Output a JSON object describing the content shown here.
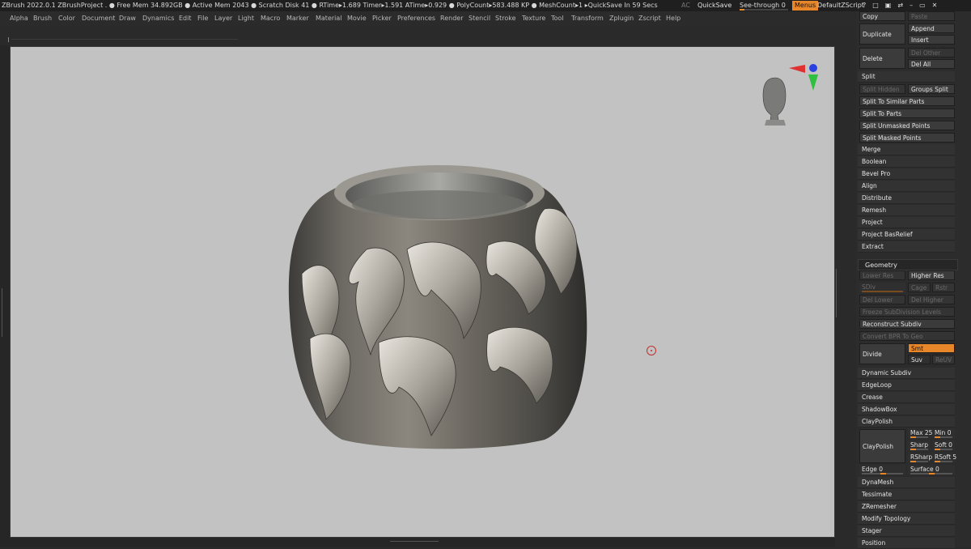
{
  "titlebar": {
    "text": "ZBrush 2022.0.1    ZBrushProject    . ● Free Mem 34.892GB ● Active Mem 2043 ● Scratch Disk 41 ●  RTime▸1.689 Timer▸1.591 ATime▸0.929 ● PolyCount▸583.488 KP ● MeshCount▸1    ▸QuickSave In 59 Secs",
    "ac": "AC",
    "quicksave": "QuickSave",
    "see_through": "See-through  0",
    "see_through_value": 0,
    "menus": "Menus",
    "default_zscript": "DefaultZScript",
    "icon_names": [
      "help-icon",
      "layout-icon",
      "palette-icon",
      "swap-icon",
      "minimize-icon",
      "maximize-icon",
      "close-icon"
    ],
    "icon_glyphs": "?□▣⇄–▭✕"
  },
  "menubar": [
    "Alpha",
    "Brush",
    "Color",
    "Document",
    "Draw",
    "Dynamics",
    "Edit",
    "File",
    "Layer",
    "Light",
    "Macro",
    "Marker",
    "Material",
    "Movie",
    "Picker",
    "Preferences",
    "Render",
    "Stencil",
    "Stroke",
    "Texture",
    "Tool",
    "Transform",
    "Zplugin",
    "Zscript",
    "Help"
  ],
  "subtool_panel": {
    "copy": "Copy",
    "paste": "Paste",
    "duplicate": "Duplicate",
    "append": "Append",
    "insert": "Insert",
    "delete": "Delete",
    "del_other": "Del Other",
    "del_all": "Del All",
    "split": "Split",
    "split_hidden": "Split Hidden",
    "groups_split": "Groups Split",
    "split_similar": "Split To Similar Parts",
    "split_parts": "Split To Parts",
    "split_unmasked": "Split Unmasked Points",
    "split_masked": "Split Masked Points",
    "merge": "Merge",
    "boolean": "Boolean",
    "bevel_pro": "Bevel Pro",
    "align": "Align",
    "distribute": "Distribute",
    "remesh": "Remesh",
    "project": "Project",
    "project_basrelief": "Project BasRelief",
    "extract": "Extract"
  },
  "geometry_panel": {
    "header": "Geometry",
    "lower_res": "Lower Res",
    "higher_res": "Higher Res",
    "sdiv": "SDiv",
    "cage": "Cage",
    "rstr": "Rstr",
    "del_lower": "Del Lower",
    "del_higher": "Del Higher",
    "freeze_subdivision": "Freeze SubDivision Levels",
    "reconstruct_subdiv": "Reconstruct Subdiv",
    "convert_bpr": "Convert BPR To Geo",
    "divide": "Divide",
    "smt": "Smt",
    "suv": "Suv",
    "reuv": "ReUV",
    "dynamic_subdiv": "Dynamic Subdiv",
    "edgeloop": "EdgeLoop",
    "crease": "Crease",
    "shadowbox": "ShadowBox",
    "claypolish_header": "ClayPolish",
    "claypolish": "ClayPolish",
    "max": "Max 25",
    "min": "Min 0",
    "sharp": "Sharp",
    "soft": "Soft 0",
    "rsharp": "RSharp",
    "rsoft": "RSoft 5",
    "edge": "Edge 0",
    "surface": "Surface 0",
    "dynamesh": "DynaMesh",
    "tessimate": "Tessimate",
    "zremesher": "ZRemesher",
    "modify_topology": "Modify Topology",
    "stager": "Stager",
    "position": "Position"
  },
  "colors": {
    "accent": "#e8862a",
    "canvas": "#c2c2c2",
    "panel": "#2c2c2c"
  }
}
